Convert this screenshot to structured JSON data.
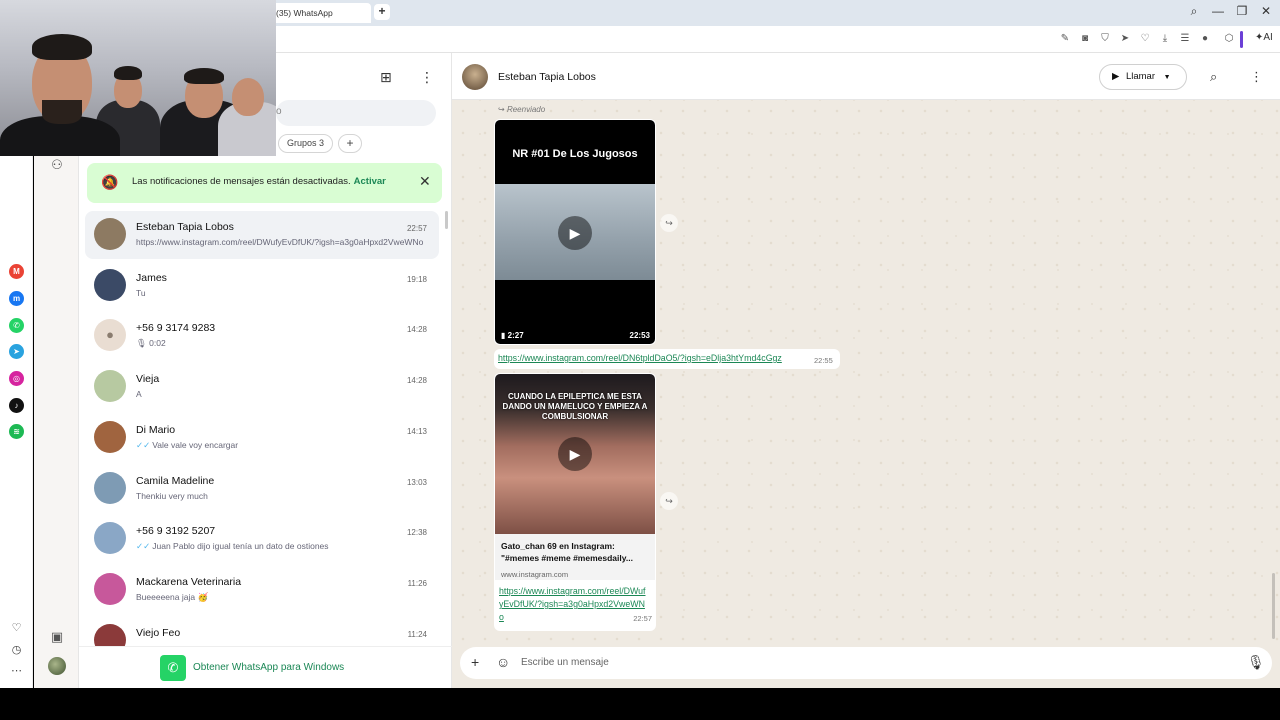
{
  "browser": {
    "tab_title": "(35) WhatsApp",
    "new_tab": "+",
    "ai_label": "AI"
  },
  "whatsapp": {
    "filters": {
      "groups_label": "Grupos",
      "groups_count": "3"
    },
    "notification": {
      "text": "Las notificaciones de mensajes están desactivadas.",
      "action": "Activar"
    },
    "chats": [
      {
        "name": "Esteban Tapia Lobos",
        "time": "22:57",
        "preview": "https://www.instagram.com/reel/DWufyEvDfUK/?igsh=a3g0aHpxd2VweWNo",
        "ticks": "",
        "active": true,
        "avatar": "#8d7a62"
      },
      {
        "name": "James",
        "time": "19:18",
        "preview": "Tu",
        "ticks": "",
        "avatar": "#3b4a66"
      },
      {
        "name": "+56 9 3174 9283",
        "time": "14:28",
        "preview": "0:02",
        "ticks": "",
        "voice": true,
        "avatar": "#e9ddd2"
      },
      {
        "name": "Vieja",
        "time": "14:28",
        "preview": "A",
        "ticks": "",
        "avatar": "#b7c9a1"
      },
      {
        "name": "Di Mario",
        "time": "14:13",
        "preview": "Vale vale voy encargar",
        "ticks": "✓✓",
        "avatar": "#a0643f"
      },
      {
        "name": "Camila Madeline",
        "time": "13:03",
        "preview": "Thenkiu very much",
        "ticks": "",
        "avatar": "#7e9bb4"
      },
      {
        "name": "+56 9 3192 5207",
        "time": "12:38",
        "preview": "Juan Pablo dijo igual tenía un dato de ostiones",
        "ticks": "✓✓",
        "avatar": "#8aa7c6"
      },
      {
        "name": "Mackarena Veterinaria",
        "time": "11:26",
        "preview": "Bueeeeena jaja 🥳",
        "ticks": "",
        "avatar": "#c7589b"
      },
      {
        "name": "Viejo Feo",
        "time": "11:24",
        "preview": "",
        "ticks": "",
        "avatar": "#8b3a3a"
      }
    ],
    "promo": "Obtener WhatsApp para Windows",
    "conversation": {
      "contact": "Esteban Tapia Lobos",
      "call_label": "Llamar",
      "forwarded_label": "Reenviado",
      "video1": {
        "title": "NR #01 De Los Jugosos",
        "duration": "2:27",
        "time": "22:53"
      },
      "link1": {
        "url": "https://www.instagram.com/reel/DN6tpldDaO5/?igsh=eDlja3htYmd4cGgz",
        "time": "22:55"
      },
      "card": {
        "caption": "CUANDO LA EPILEPTICA ME ESTA DANDO UN MAMELUCO Y EMPIEZA A COMBULSIONAR",
        "title": "Gato_chan 69 en Instagram: \"#memes #meme #memesdaily...",
        "domain": "www.instagram.com",
        "url": "https://www.instagram.com/reel/DWufyEvDfUK/?igsh=a3g0aHpxd2VweWNo",
        "time": "22:57"
      },
      "composer_placeholder": "Escribe un mensaje"
    }
  },
  "colors": {
    "accent": "#25d366",
    "link": "#1b8755",
    "banner": "#d9fdd3",
    "chat_bg": "#efeae2"
  }
}
